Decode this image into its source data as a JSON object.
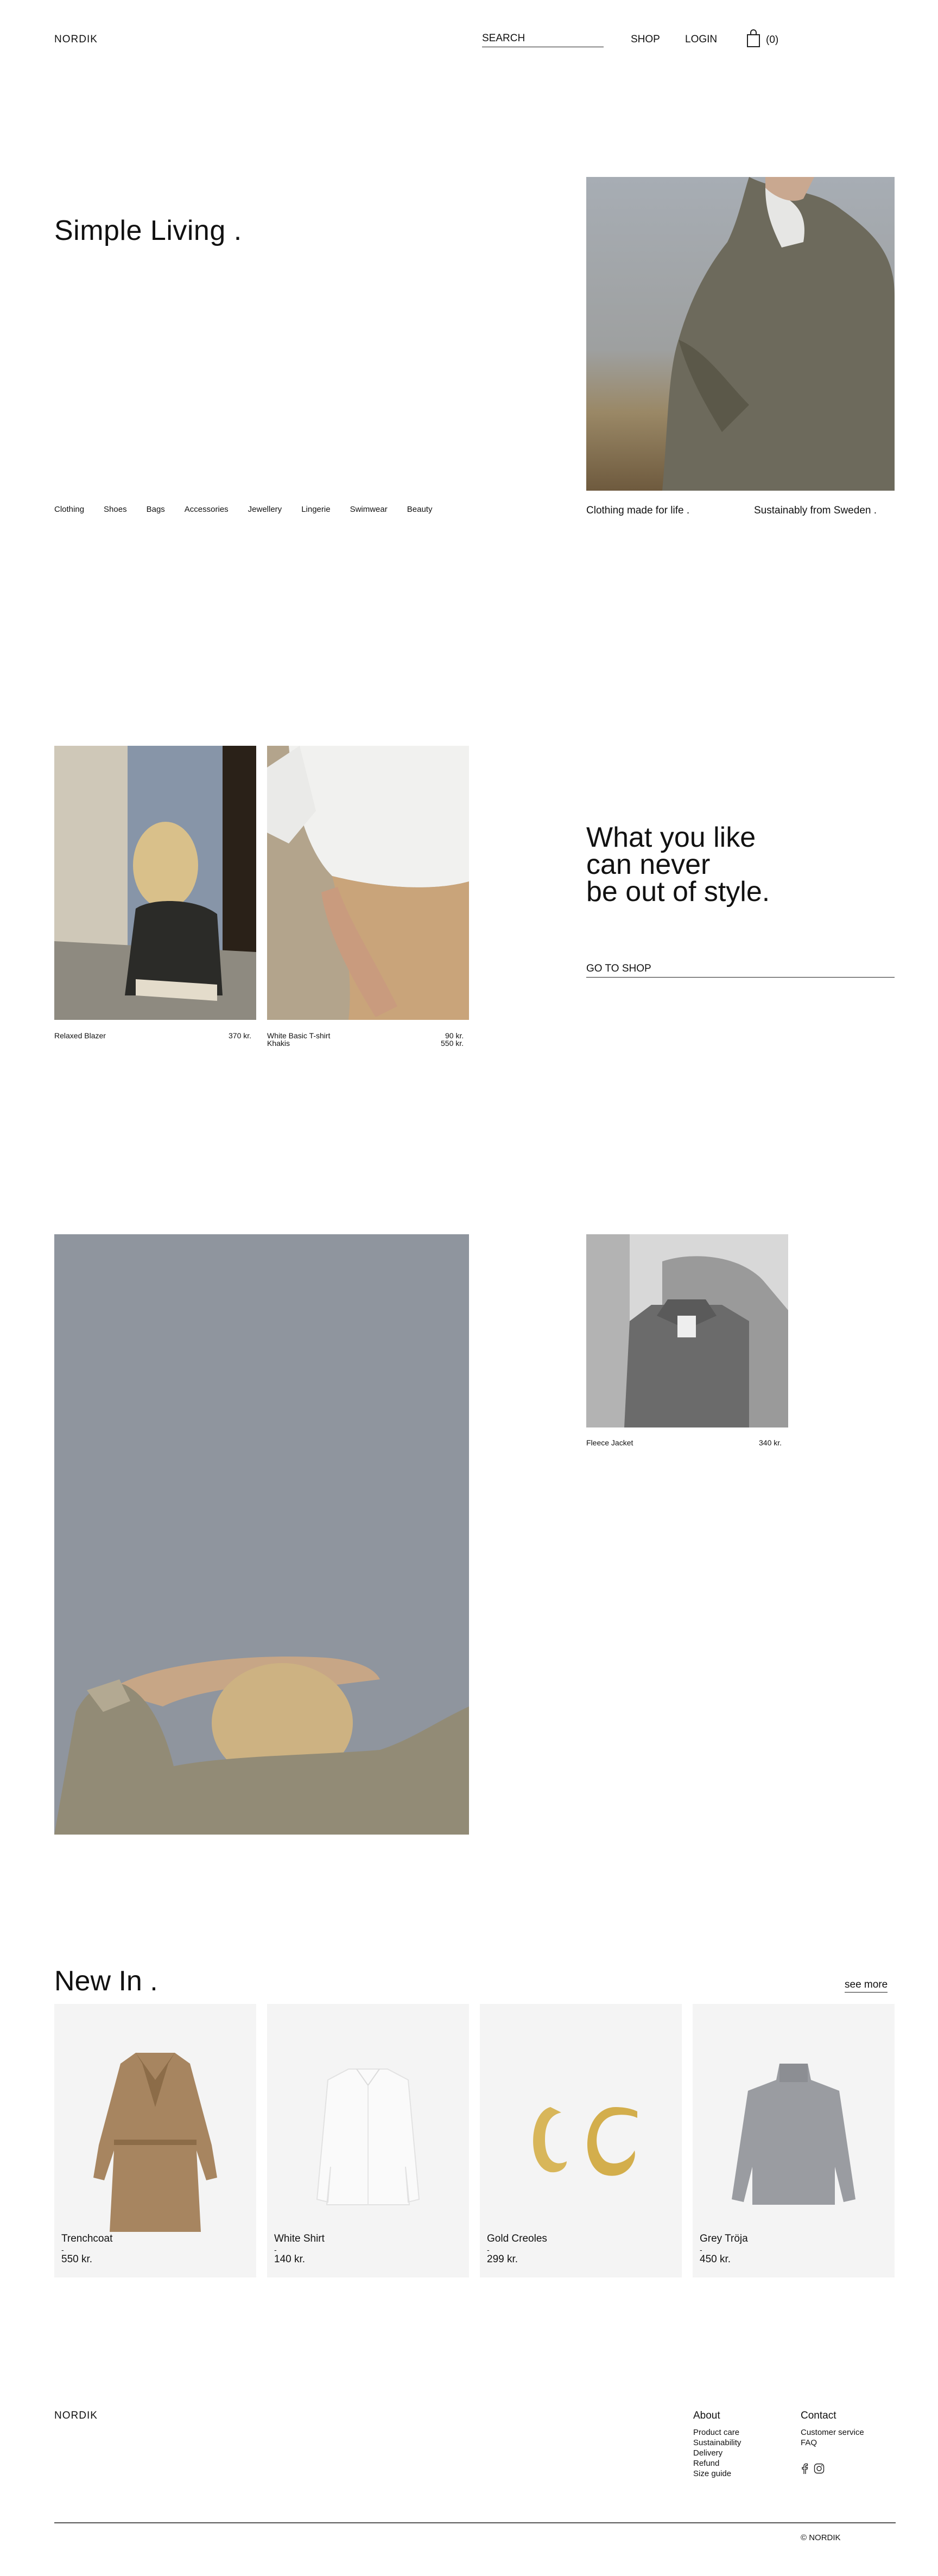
{
  "header": {
    "logo": "NORDIK",
    "search_label": "SEARCH",
    "nav": {
      "shop": "SHOP",
      "login": "LOGIN"
    },
    "cart_count": "(0)"
  },
  "hero": {
    "title": "Simple Living .",
    "categories": [
      "Clothing",
      "Shoes",
      "Bags",
      "Accessories",
      "Jewellery",
      "Lingerie",
      "Swimwear",
      "Beauty"
    ],
    "caption_left": "Clothing made for life .",
    "caption_right": "Sustainably from Sweden ."
  },
  "featured": {
    "items": [
      {
        "name": "Relaxed Blazer",
        "price": "370 kr."
      },
      {
        "name": "White Basic T-shirt",
        "name2": "Khakis",
        "price": "90 kr.",
        "price2": "550 kr."
      }
    ],
    "tagline": [
      "What you like",
      "can never",
      "be out of style."
    ],
    "cta": "GO TO SHOP"
  },
  "fleece": {
    "name": "Fleece Jacket",
    "price": "340 kr."
  },
  "new_in": {
    "title": "New In .",
    "see_more": "see more",
    "products": [
      {
        "name": "Trenchcoat",
        "dash": "-",
        "price": "550 kr."
      },
      {
        "name": "White Shirt",
        "dash": "-",
        "price": "140 kr."
      },
      {
        "name": "Gold Creoles",
        "dash": "-",
        "price": "299 kr."
      },
      {
        "name": "Grey Tröja",
        "dash": "-",
        "price": "450 kr."
      }
    ]
  },
  "footer": {
    "logo": "NORDIK",
    "about": {
      "title": "About",
      "links": [
        "Product care",
        "Sustainability",
        "Delivery",
        "Refund",
        "Size guide"
      ]
    },
    "contact": {
      "title": "Contact",
      "links": [
        "Customer service",
        "FAQ"
      ]
    },
    "copyright": "© NORDIK"
  }
}
